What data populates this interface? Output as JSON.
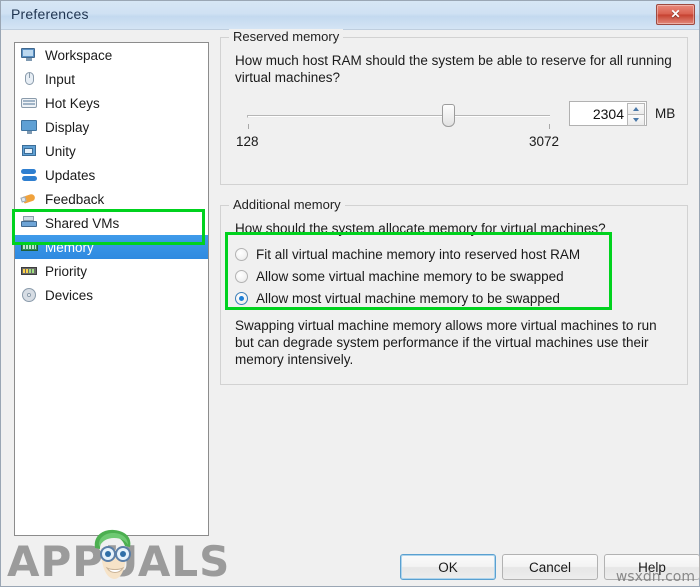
{
  "window": {
    "title": "Preferences",
    "close_label": "✕",
    "close_icon": "close-icon"
  },
  "sidebar": {
    "items": [
      {
        "label": "Workspace",
        "icon": "monitor-icon",
        "selected": false
      },
      {
        "label": "Input",
        "icon": "mouse-icon",
        "selected": false
      },
      {
        "label": "Hot Keys",
        "icon": "keyboard-icon",
        "selected": false
      },
      {
        "label": "Display",
        "icon": "display-icon",
        "selected": false
      },
      {
        "label": "Unity",
        "icon": "unity-window-icon",
        "selected": false
      },
      {
        "label": "Updates",
        "icon": "refresh-icon",
        "selected": false
      },
      {
        "label": "Feedback",
        "icon": "megaphone-icon",
        "selected": false
      },
      {
        "label": "Shared VMs",
        "icon": "shared-vms-icon",
        "selected": false
      },
      {
        "label": "Memory",
        "icon": "memory-stick-icon",
        "selected": true
      },
      {
        "label": "Priority",
        "icon": "priority-icon",
        "selected": false
      },
      {
        "label": "Devices",
        "icon": "disc-icon",
        "selected": false
      }
    ]
  },
  "reserved_memory": {
    "legend": "Reserved memory",
    "question": "How much host RAM should the system be able to reserve for all running virtual machines?",
    "slider": {
      "min_label": "128",
      "max_label": "3072",
      "min": 128,
      "max": 3072,
      "value": 2304
    },
    "spinner": {
      "value": "2304",
      "unit": "MB",
      "up_icon": "spinner-up-arrow-icon",
      "down_icon": "spinner-down-arrow-icon"
    }
  },
  "additional_memory": {
    "legend": "Additional memory",
    "question": "How should the system allocate memory for virtual machines?",
    "options": [
      {
        "label": "Fit all virtual machine memory into reserved host RAM",
        "selected": false
      },
      {
        "label": "Allow some virtual machine memory to be swapped",
        "selected": false
      },
      {
        "label": "Allow most virtual machine memory to be swapped",
        "selected": true
      }
    ],
    "note": "Swapping virtual machine memory allows more virtual machines to run but can degrade system performance if the virtual machines use their memory intensively."
  },
  "buttons": {
    "ok": "OK",
    "cancel": "Cancel",
    "help": "Help"
  },
  "annotations": {
    "color": "#00d21e",
    "boxes": [
      "memory-sidebar-item",
      "additional-memory-options"
    ]
  },
  "watermarks": {
    "brand": "APPUALS",
    "corner": "wsxdn.com"
  }
}
